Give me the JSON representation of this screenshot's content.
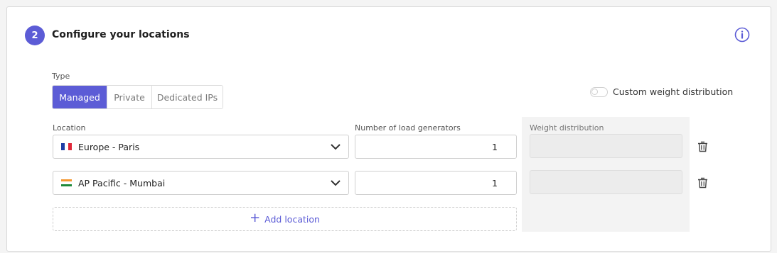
{
  "section": {
    "step_number": "2",
    "title": "Configure your locations"
  },
  "type_selector": {
    "label": "Type",
    "options": [
      {
        "label": "Managed",
        "selected": true
      },
      {
        "label": "Private",
        "selected": false
      },
      {
        "label": "Dedicated IPs",
        "selected": false
      }
    ]
  },
  "custom_weight": {
    "label": "Custom weight distribution",
    "enabled": false
  },
  "columns": {
    "location": "Location",
    "load_generators": "Number of load generators",
    "weight": "Weight distribution"
  },
  "locations": [
    {
      "flag": "fr",
      "name": "Europe - Paris",
      "load_generators": "1",
      "weight": ""
    },
    {
      "flag": "in",
      "name": "AP Pacific - Mumbai",
      "load_generators": "1",
      "weight": ""
    }
  ],
  "add_location": {
    "label": "Add location"
  },
  "icons": {
    "info": "info-icon",
    "dropdown": "chevron-down-icon",
    "delete": "trash-icon",
    "add": "plus-icon"
  },
  "colors": {
    "accent": "#5c5cd6",
    "border": "#cfcfcf",
    "weight_panel_bg": "#f3f3f3"
  }
}
